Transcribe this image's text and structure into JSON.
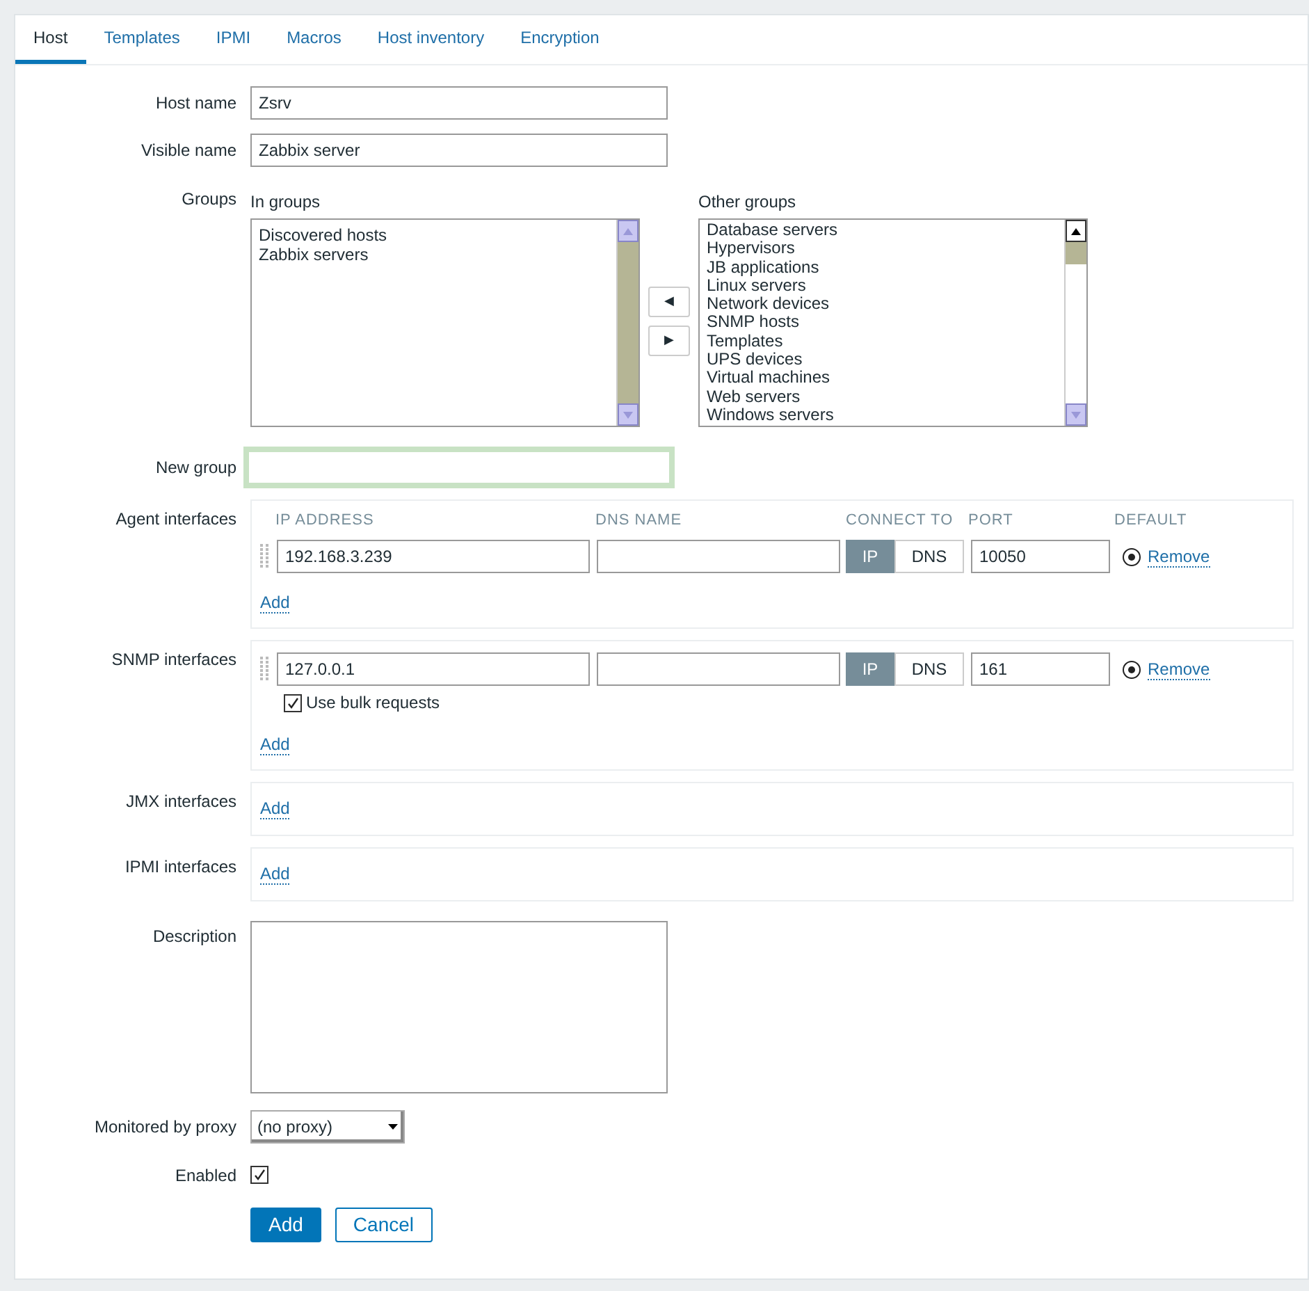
{
  "tabs": [
    {
      "label": "Host",
      "selected": true
    },
    {
      "label": "Templates",
      "selected": false
    },
    {
      "label": "IPMI",
      "selected": false
    },
    {
      "label": "Macros",
      "selected": false
    },
    {
      "label": "Host inventory",
      "selected": false
    },
    {
      "label": "Encryption",
      "selected": false
    }
  ],
  "host_name": {
    "label": "Host name",
    "value": "Zsrv"
  },
  "visible_name": {
    "label": "Visible name",
    "value": "Zabbix server"
  },
  "groups": {
    "label": "Groups",
    "in_groups_label": "In groups",
    "in_groups": [
      "Discovered hosts",
      "Zabbix servers"
    ],
    "other_groups_label": "Other groups",
    "other_groups": [
      "Database servers",
      "Hypervisors",
      "JB applications",
      "Linux servers",
      "Network devices",
      "SNMP hosts",
      "Templates",
      "UPS devices",
      "Virtual machines",
      "Web servers",
      "Windows servers"
    ],
    "move_left": "◀",
    "move_right": "▶"
  },
  "new_group": {
    "label": "New group"
  },
  "interfaces": [
    {
      "label": "Agent interfaces",
      "columns": [
        "IP ADDRESS",
        "DNS NAME",
        "CONNECT TO",
        "PORT",
        "DEFAULT"
      ],
      "rows": [
        {
          "ip": "192.168.3.239",
          "dns": "",
          "connect": [
            {
              "label": "IP",
              "selected": true
            },
            {
              "label": "DNS",
              "selected": false
            }
          ],
          "port": "10050",
          "default": true,
          "remove": "Remove"
        }
      ],
      "add": "Add"
    },
    {
      "label": "SNMP interfaces",
      "rows": [
        {
          "ip": "127.0.0.1",
          "dns": "",
          "connect": [
            {
              "label": "IP",
              "selected": true
            },
            {
              "label": "DNS",
              "selected": false
            }
          ],
          "port": "161",
          "default": true,
          "remove": "Remove",
          "bulk": {
            "label": "Use bulk requests",
            "checked": true
          }
        }
      ],
      "add": "Add"
    },
    {
      "label": "JMX interfaces",
      "add": "Add"
    },
    {
      "label": "IPMI interfaces",
      "add": "Add"
    }
  ],
  "description": {
    "label": "Description"
  },
  "proxy": {
    "label": "Monitored by proxy",
    "value": "(no proxy)"
  },
  "enabled": {
    "label": "Enabled",
    "checked": true
  },
  "buttons": [
    {
      "label": "Add",
      "kind": "primary"
    },
    {
      "label": "Cancel",
      "kind": "secondary"
    }
  ]
}
